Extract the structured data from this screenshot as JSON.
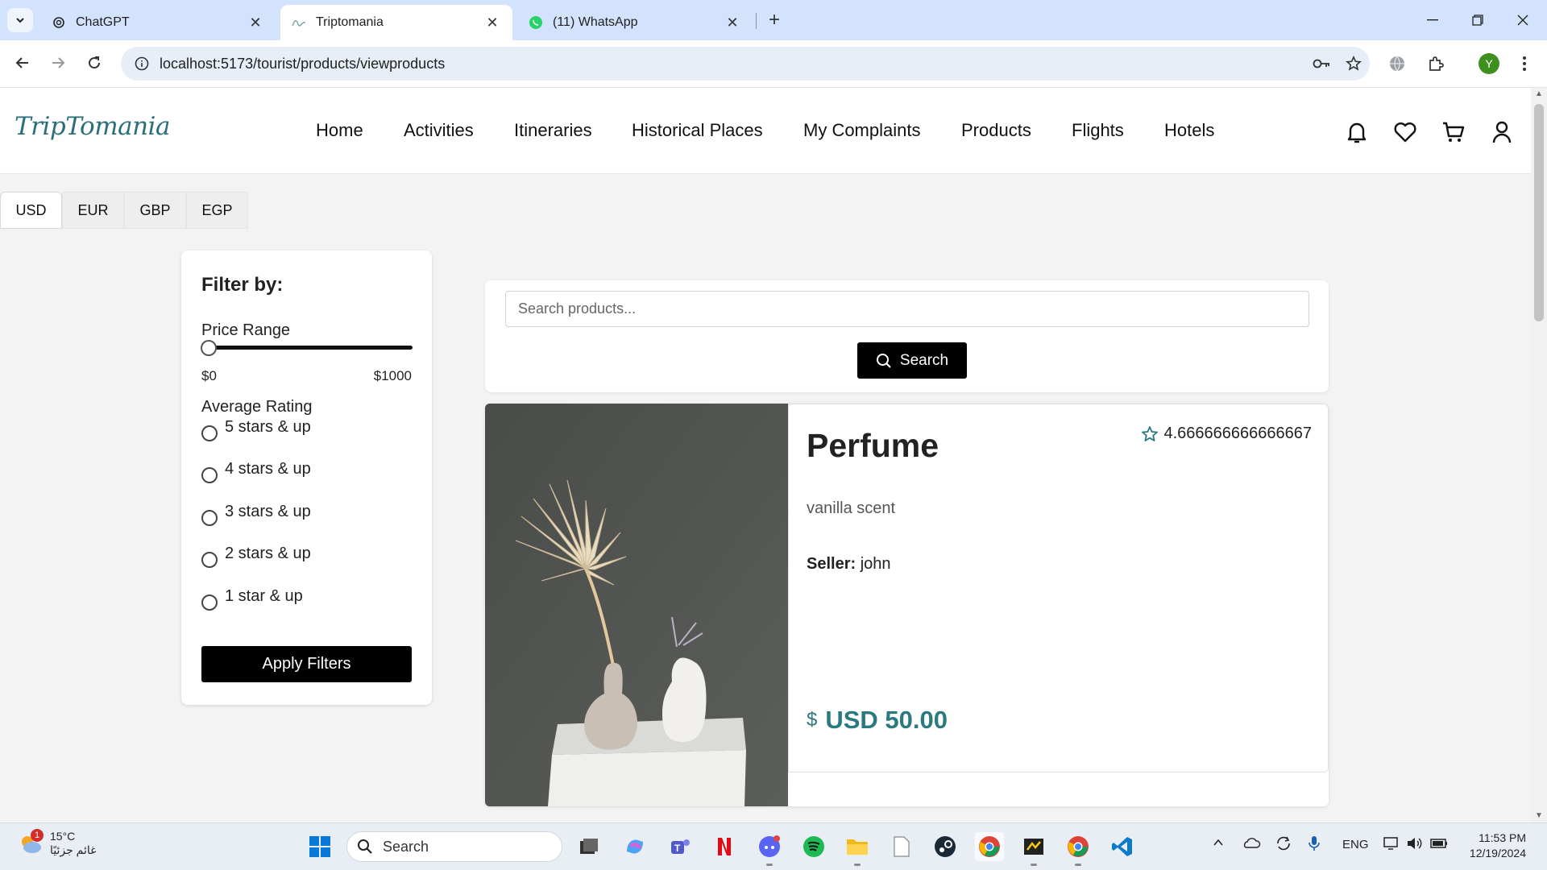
{
  "browser": {
    "tabs": [
      {
        "title": "ChatGPT",
        "icon": "chatgpt-icon",
        "active": false
      },
      {
        "title": "Triptomania",
        "icon": "site-favicon",
        "active": true
      },
      {
        "title": "(11) WhatsApp",
        "icon": "whatsapp-icon",
        "active": false
      }
    ],
    "url": "localhost:5173/tourist/products/viewproducts",
    "profile_initial": "Y"
  },
  "site": {
    "logo": "TripTomania",
    "nav": [
      "Home",
      "Activities",
      "Itineraries",
      "Historical Places",
      "My Complaints",
      "Products",
      "Flights",
      "Hotels"
    ],
    "currencies": [
      "USD",
      "EUR",
      "GBP",
      "EGP"
    ],
    "selected_currency": "USD",
    "accent_color": "#2b7a80"
  },
  "filters": {
    "title": "Filter by:",
    "price_label": "Price Range",
    "price_min": "$0",
    "price_max": "$1000",
    "price_selected_fraction": 0,
    "rating_label": "Average Rating",
    "rating_options": [
      "5 stars & up",
      "4 stars & up",
      "3 stars & up",
      "2 stars & up",
      "1 star & up"
    ],
    "apply_label": "Apply Filters"
  },
  "search": {
    "placeholder": "Search products...",
    "button_label": "Search"
  },
  "products": [
    {
      "name": "Perfume",
      "rating": "4.666666666666667",
      "description": "vanilla scent",
      "seller_label": "Seller:",
      "seller": "john",
      "price": "USD 50.00"
    }
  ],
  "taskbar": {
    "weather_temp": "15°C",
    "weather_desc": "غائم جزئيًا",
    "weather_badge": "1",
    "search_label": "Search",
    "language": "ENG",
    "time": "11:53 PM",
    "date": "12/19/2024"
  }
}
